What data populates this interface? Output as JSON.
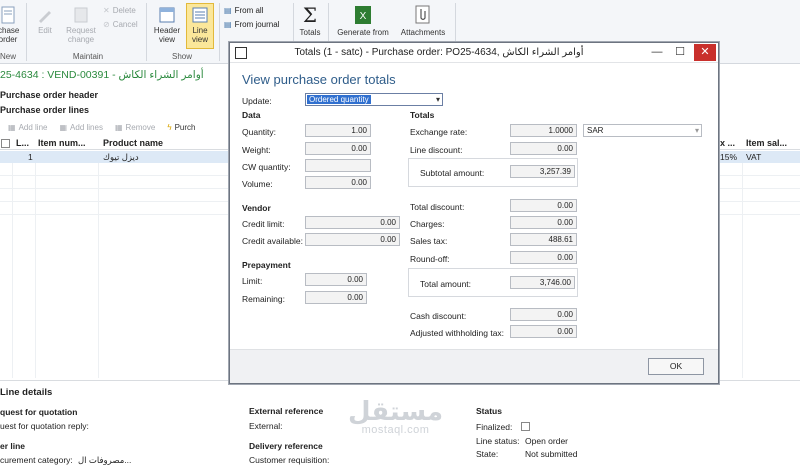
{
  "ribbon": {
    "purchase_order_label": "chase\norder",
    "new_label": "New",
    "edit_label": "Edit",
    "request_change_label": "Request\nchange",
    "delete_label": "Delete",
    "cancel_label": "Cancel",
    "maintain_group": "Maintain",
    "header_view_label": "Header\nview",
    "line_view_label": "Line\nview",
    "show_group": "Show",
    "from_all_label": "From all",
    "from_journal_label": "From journal",
    "totals_label": "Totals",
    "generate_from_label": "Generate from",
    "attachments_label": "Attachments"
  },
  "form": {
    "title_line": "25-4634 : VEND-00391 - أوامر الشراء الكاش",
    "header_section": "Purchase order header",
    "lines_section": "Purchase order lines",
    "add_line": "Add line",
    "add_lines": "Add lines",
    "remove": "Remove",
    "purch_trunc": "Purch",
    "columns": {
      "col_l": "L...",
      "item_number": "Item num...",
      "product_name": "Product name",
      "col_x": "x ...",
      "item_sales_tax": "Item sal..."
    },
    "row": {
      "line": "1",
      "product": "ديزل تيوك",
      "tax_pct": "15%",
      "tax_group": "VAT"
    }
  },
  "line_details": {
    "title": "Line details",
    "rfq_heading": "quest for quotation",
    "rfq_reply": "uest for quotation reply:",
    "other_line": "er line",
    "procurement_category": "curement category:",
    "procurement_value": "مصروفات ال...",
    "external_reference": "External reference",
    "external_label": "External:",
    "delivery_reference": "Delivery reference",
    "customer_requisition": "Customer requisition:",
    "status": "Status",
    "finalized_label": "Finalized:",
    "line_status_label": "Line status:",
    "line_status_value": "Open order",
    "state_label": "State:",
    "state_value": "Not submitted"
  },
  "watermark": {
    "arabic": "مستقل",
    "latin": "mostaql.com"
  },
  "dialog": {
    "title": "Totals (1 - satc) - Purchase order: PO25-4634, أوامر الشراء الكاش",
    "heading": "View purchase order totals",
    "update_label": "Update:",
    "update_value": "Ordered quantity",
    "data_heading": "Data",
    "quantity_label": "Quantity:",
    "quantity": "1.00",
    "weight_label": "Weight:",
    "weight": "0.00",
    "cw_quantity_label": "CW quantity:",
    "cw_quantity": "",
    "volume_label": "Volume:",
    "volume": "0.00",
    "vendor_heading": "Vendor",
    "credit_limit_label": "Credit limit:",
    "credit_limit": "0.00",
    "credit_available_label": "Credit available:",
    "credit_available": "0.00",
    "prepayment_heading": "Prepayment",
    "limit_label": "Limit:",
    "limit": "0.00",
    "remaining_label": "Remaining:",
    "remaining": "0.00",
    "totals_heading": "Totals",
    "exchange_rate_label": "Exchange rate:",
    "exchange_rate": "1.0000",
    "currency": "SAR",
    "line_discount_label": "Line discount:",
    "line_discount": "0.00",
    "subtotal_label": "Subtotal amount:",
    "subtotal": "3,257.39",
    "total_discount_label": "Total discount:",
    "total_discount": "0.00",
    "charges_label": "Charges:",
    "charges": "0.00",
    "sales_tax_label": "Sales tax:",
    "sales_tax": "488.61",
    "round_off_label": "Round-off:",
    "round_off": "0.00",
    "total_amount_label": "Total amount:",
    "total_amount": "3,746.00",
    "cash_discount_label": "Cash discount:",
    "cash_discount": "0.00",
    "adjusted_withholding_label": "Adjusted withholding tax:",
    "adjusted_withholding": "0.00",
    "ok_label": "OK",
    "minimize_glyph": "—",
    "maximize_glyph": "☐",
    "close_glyph": "✕"
  }
}
